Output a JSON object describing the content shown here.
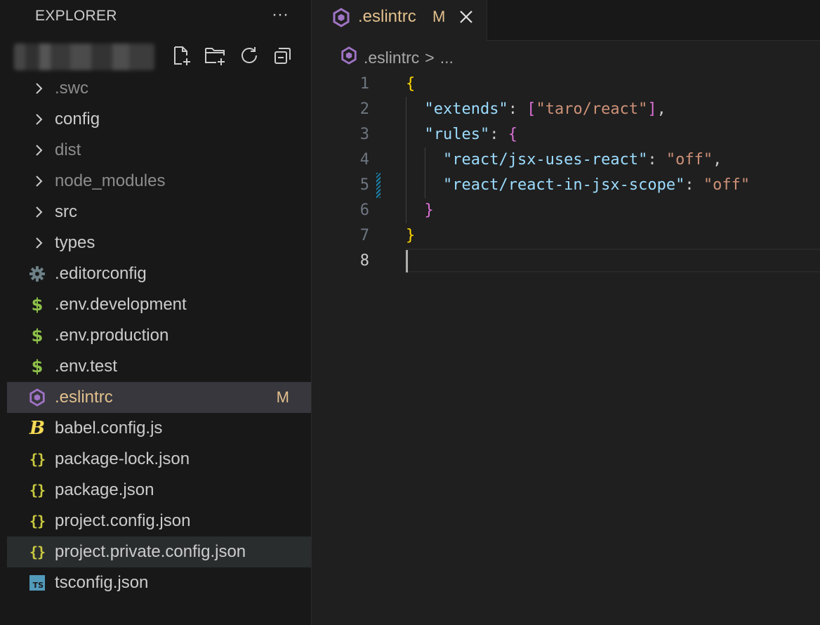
{
  "sidebar": {
    "title": "EXPLORER",
    "more_label": "···",
    "toolbar_icons": [
      "new-file-icon",
      "new-folder-icon",
      "refresh-icon",
      "collapse-all-icon"
    ],
    "items": [
      {
        "label": ".swc",
        "type": "folder",
        "dim": true
      },
      {
        "label": "config",
        "type": "folder",
        "dim": false
      },
      {
        "label": "dist",
        "type": "folder",
        "dim": true
      },
      {
        "label": "node_modules",
        "type": "folder",
        "dim": true
      },
      {
        "label": "src",
        "type": "folder",
        "dim": false
      },
      {
        "label": "types",
        "type": "folder",
        "dim": false
      },
      {
        "label": ".editorconfig",
        "type": "file",
        "icon": "gear-icon"
      },
      {
        "label": ".env.development",
        "type": "file",
        "icon": "dollar-icon"
      },
      {
        "label": ".env.production",
        "type": "file",
        "icon": "dollar-icon"
      },
      {
        "label": ".env.test",
        "type": "file",
        "icon": "dollar-icon"
      },
      {
        "label": ".eslintrc",
        "type": "file",
        "icon": "eslint-icon",
        "badge": "M",
        "selected": true
      },
      {
        "label": "babel.config.js",
        "type": "file",
        "icon": "babel-icon"
      },
      {
        "label": "package-lock.json",
        "type": "file",
        "icon": "json-icon"
      },
      {
        "label": "package.json",
        "type": "file",
        "icon": "json-icon"
      },
      {
        "label": "project.config.json",
        "type": "file",
        "icon": "json-icon"
      },
      {
        "label": "project.private.config.json",
        "type": "file",
        "icon": "json-icon",
        "hovered": true
      },
      {
        "label": "tsconfig.json",
        "type": "file",
        "icon": "typescript-icon"
      }
    ]
  },
  "tab": {
    "label": ".eslintrc",
    "modified_badge": "M",
    "ts_text": "TS"
  },
  "breadcrumbs": {
    "file": ".eslintrc",
    "separator": ">",
    "rest": "..."
  },
  "editor": {
    "lines": [
      {
        "num": "1",
        "tokens": [
          {
            "t": "{",
            "c": "k-brace1"
          }
        ]
      },
      {
        "num": "2",
        "tokens": [
          {
            "t": "  ",
            "c": "k-punct"
          },
          {
            "t": "\"extends\"",
            "c": "k-key"
          },
          {
            "t": ": ",
            "c": "k-punct"
          },
          {
            "t": "[",
            "c": "k-brace2"
          },
          {
            "t": "\"taro/react\"",
            "c": "k-str"
          },
          {
            "t": "]",
            "c": "k-brace2"
          },
          {
            "t": ",",
            "c": "k-punct"
          }
        ]
      },
      {
        "num": "3",
        "tokens": [
          {
            "t": "  ",
            "c": "k-punct"
          },
          {
            "t": "\"rules\"",
            "c": "k-key"
          },
          {
            "t": ": ",
            "c": "k-punct"
          },
          {
            "t": "{",
            "c": "k-brace2"
          }
        ]
      },
      {
        "num": "4",
        "tokens": [
          {
            "t": "    ",
            "c": "k-punct"
          },
          {
            "t": "\"react/jsx-uses-react\"",
            "c": "k-key"
          },
          {
            "t": ": ",
            "c": "k-punct"
          },
          {
            "t": "\"off\"",
            "c": "k-str"
          },
          {
            "t": ",",
            "c": "k-punct"
          }
        ]
      },
      {
        "num": "5",
        "tokens": [
          {
            "t": "    ",
            "c": "k-punct"
          },
          {
            "t": "\"react/react-in-jsx-scope\"",
            "c": "k-key"
          },
          {
            "t": ": ",
            "c": "k-punct"
          },
          {
            "t": "\"off\"",
            "c": "k-str"
          }
        ]
      },
      {
        "num": "6",
        "tokens": [
          {
            "t": "  ",
            "c": "k-punct"
          },
          {
            "t": "}",
            "c": "k-brace2"
          }
        ]
      },
      {
        "num": "7",
        "tokens": [
          {
            "t": "}",
            "c": "k-brace1"
          }
        ]
      },
      {
        "num": "8",
        "tokens": [],
        "active": true
      }
    ]
  },
  "colors": {
    "eslint": "#a074c4",
    "modified": "#e2c08d",
    "gear": "#6d8086"
  }
}
